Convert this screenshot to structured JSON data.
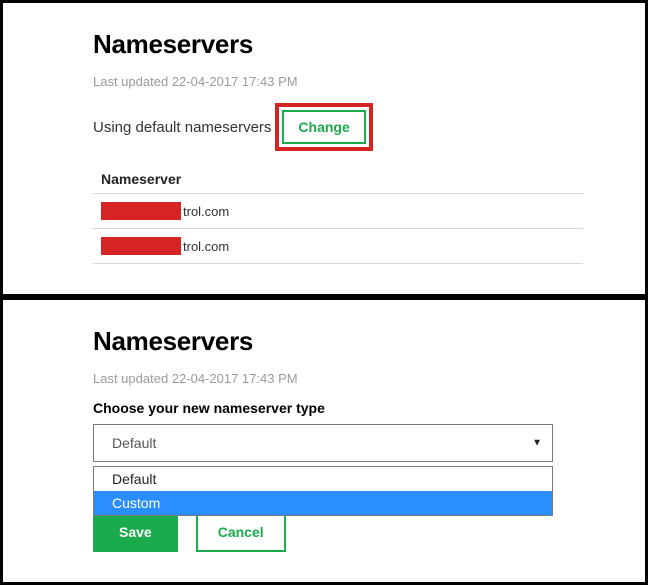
{
  "panel1": {
    "title": "Nameservers",
    "last_updated_label": "Last updated",
    "last_updated_value": "22-04-2017 17:43 PM",
    "using_text": "Using default nameservers",
    "change_label": "Change",
    "ns_header": "Nameserver",
    "ns_rows": [
      {
        "suffix": "trol.com"
      },
      {
        "suffix": "trol.com"
      }
    ]
  },
  "panel2": {
    "title": "Nameservers",
    "last_updated_label": "Last updated",
    "last_updated_value": "22-04-2017 17:43 PM",
    "choose_label": "Choose your new nameserver type",
    "selected": "Default",
    "options": [
      "Default",
      "Custom"
    ],
    "save_label": "Save",
    "cancel_label": "Cancel"
  }
}
